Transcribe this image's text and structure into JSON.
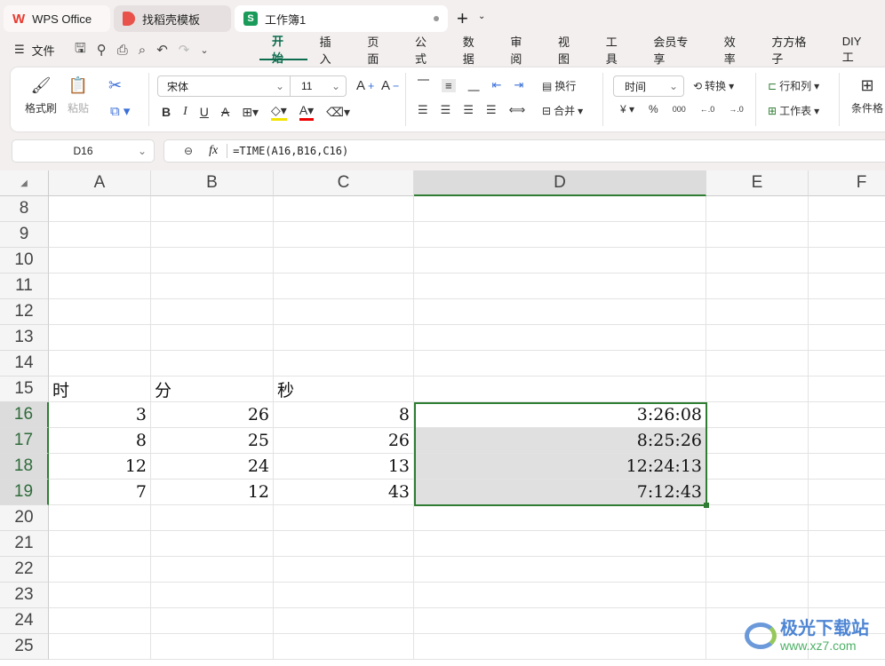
{
  "tabs": [
    {
      "label": "WPS Office",
      "icon": "wps-logo-icon"
    },
    {
      "label": "找稻壳模板",
      "icon": "docer-icon"
    },
    {
      "label": "工作簿1",
      "icon": "spreadsheet-icon"
    }
  ],
  "menu": {
    "file": "文件",
    "items": [
      "开始",
      "插入",
      "页面",
      "公式",
      "数据",
      "审阅",
      "视图",
      "工具",
      "会员专享",
      "效率",
      "方方格子",
      "DIY工"
    ],
    "active": "开始"
  },
  "ribbon": {
    "format_painter": "格式刷",
    "paste": "粘贴",
    "font": "宋体",
    "font_size": "11",
    "wrap": "换行",
    "merge": "合并",
    "number_format": "时间",
    "convert": "转换",
    "rows_cols": "行和列",
    "worksheet": "工作表",
    "conditional": "条件格",
    "currency": "¥",
    "percent": "%",
    "thousands": "000"
  },
  "formula_bar": {
    "cell_ref": "D16",
    "fx": "fx",
    "formula": "=TIME(A16,B16,C16)"
  },
  "accent": "#2e7d32",
  "sheet": {
    "columns": [
      "A",
      "B",
      "C",
      "D",
      "E",
      "F"
    ],
    "rows": [
      8,
      9,
      10,
      11,
      12,
      13,
      14,
      15,
      16,
      17,
      18,
      19,
      20,
      21,
      22,
      23,
      24,
      25
    ],
    "cells": {
      "15": [
        "时",
        "分",
        "秒",
        "",
        "",
        ""
      ],
      "16": [
        "3",
        "26",
        "8",
        "3:26:08",
        "",
        ""
      ],
      "17": [
        "8",
        "25",
        "26",
        "8:25:26",
        "",
        ""
      ],
      "18": [
        "12",
        "24",
        "13",
        "12:24:13",
        "",
        ""
      ],
      "19": [
        "7",
        "12",
        "43",
        "7:12:43",
        "",
        ""
      ]
    },
    "selected_range": "D16:D19",
    "active_cell": "D16"
  },
  "watermark": {
    "name": "极光下载站",
    "url": "www.xz7.com"
  }
}
